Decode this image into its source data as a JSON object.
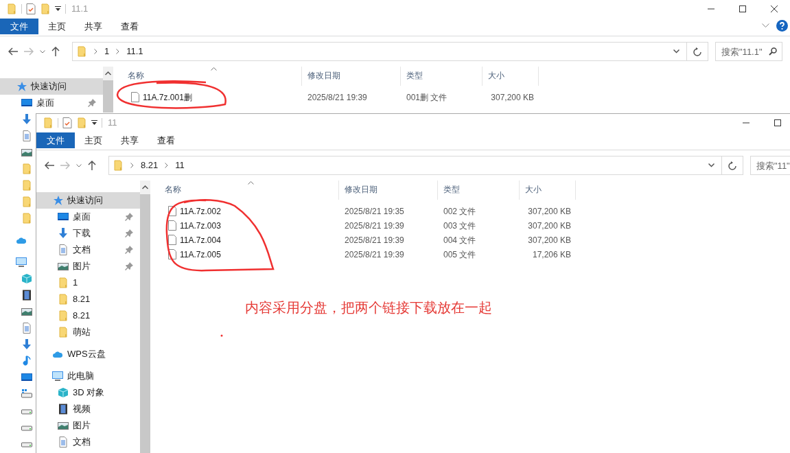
{
  "back_window": {
    "title": "11.1",
    "ribbon_tabs": [
      {
        "label": "文件",
        "selected": true
      },
      {
        "label": "主页",
        "selected": false
      },
      {
        "label": "共享",
        "selected": false
      },
      {
        "label": "查看",
        "selected": false
      }
    ],
    "path": [
      "1",
      "11.1"
    ],
    "search": {
      "placeholder": "搜索\"11.1\""
    },
    "nav_items": [
      {
        "label": "快速访问",
        "kind": "star",
        "selected": true,
        "children": [
          {
            "label": "桌面",
            "kind": "desktop",
            "selected": false,
            "pinned": true
          },
          {
            "kind": "download",
            "selected": false
          },
          {
            "kind": "doc",
            "selected": false
          },
          {
            "kind": "picture",
            "selected": false
          },
          {
            "kind": "folder",
            "selected": false
          },
          {
            "kind": "folder",
            "selected": false
          },
          {
            "kind": "folder",
            "selected": false
          },
          {
            "kind": "folder",
            "selected": false
          }
        ]
      },
      {
        "kind": "cloud",
        "selected": false
      },
      {
        "kind": "pc",
        "selected": false,
        "children": [
          {
            "kind": "cube",
            "selected": false
          },
          {
            "kind": "film",
            "selected": false
          },
          {
            "kind": "picture",
            "selected": false
          },
          {
            "kind": "doc",
            "selected": false
          },
          {
            "kind": "download",
            "selected": false
          },
          {
            "kind": "music",
            "selected": false
          },
          {
            "kind": "desktop",
            "selected": false
          },
          {
            "kind": "drive-win",
            "selected": false
          },
          {
            "kind": "drive",
            "selected": false
          },
          {
            "kind": "drive",
            "selected": false
          },
          {
            "kind": "drive",
            "selected": false
          }
        ]
      }
    ],
    "columns": [
      "名称",
      "修改日期",
      "类型",
      "大小"
    ],
    "files": [
      {
        "name": "11A.7z.001删",
        "modified": "2025/8/21 19:39",
        "type": "001删 文件",
        "size": "307,200 KB"
      }
    ]
  },
  "front_window": {
    "title": "11",
    "ribbon_tabs": [
      {
        "label": "文件",
        "selected": true
      },
      {
        "label": "主页",
        "selected": false
      },
      {
        "label": "共享",
        "selected": false
      },
      {
        "label": "查看",
        "selected": false
      }
    ],
    "path": [
      "8.21",
      "11"
    ],
    "search": {
      "placeholder": "搜索\"11\""
    },
    "nav_items": [
      {
        "label": "快速访问",
        "kind": "star",
        "selected": true,
        "children": [
          {
            "label": "桌面",
            "kind": "desktop",
            "selected": false,
            "pinned": true
          },
          {
            "label": "下载",
            "kind": "download",
            "selected": false,
            "pinned": true
          },
          {
            "label": "文档",
            "kind": "doc",
            "selected": false,
            "pinned": true
          },
          {
            "label": "图片",
            "kind": "picture",
            "selected": false,
            "pinned": true
          },
          {
            "label": "1",
            "kind": "folder",
            "selected": false
          },
          {
            "label": "8.21",
            "kind": "folder",
            "selected": false
          },
          {
            "label": "8.21",
            "kind": "folder",
            "selected": false
          },
          {
            "label": "萌站",
            "kind": "folder",
            "selected": false
          }
        ]
      },
      {
        "label": "WPS云盘",
        "kind": "cloud",
        "selected": false
      },
      {
        "label": "此电脑",
        "kind": "pc",
        "selected": false,
        "children": [
          {
            "label": "3D 对象",
            "kind": "cube",
            "selected": false
          },
          {
            "label": "视频",
            "kind": "film",
            "selected": false
          },
          {
            "label": "图片",
            "kind": "picture",
            "selected": false
          },
          {
            "label": "文档",
            "kind": "doc",
            "selected": false
          }
        ]
      }
    ],
    "columns": [
      "名称",
      "修改日期",
      "类型",
      "大小"
    ],
    "files": [
      {
        "name": "11A.7z.002",
        "modified": "2025/8/21 19:35",
        "type": "002 文件",
        "size": "307,200 KB"
      },
      {
        "name": "11A.7z.003",
        "modified": "2025/8/21 19:39",
        "type": "003 文件",
        "size": "307,200 KB"
      },
      {
        "name": "11A.7z.004",
        "modified": "2025/8/21 19:39",
        "type": "004 文件",
        "size": "307,200 KB"
      },
      {
        "name": "11A.7z.005",
        "modified": "2025/8/21 19:39",
        "type": "005 文件",
        "size": "17,206 KB"
      }
    ]
  },
  "annotation": "内容采用分盘，把两个链接下载放在一起"
}
